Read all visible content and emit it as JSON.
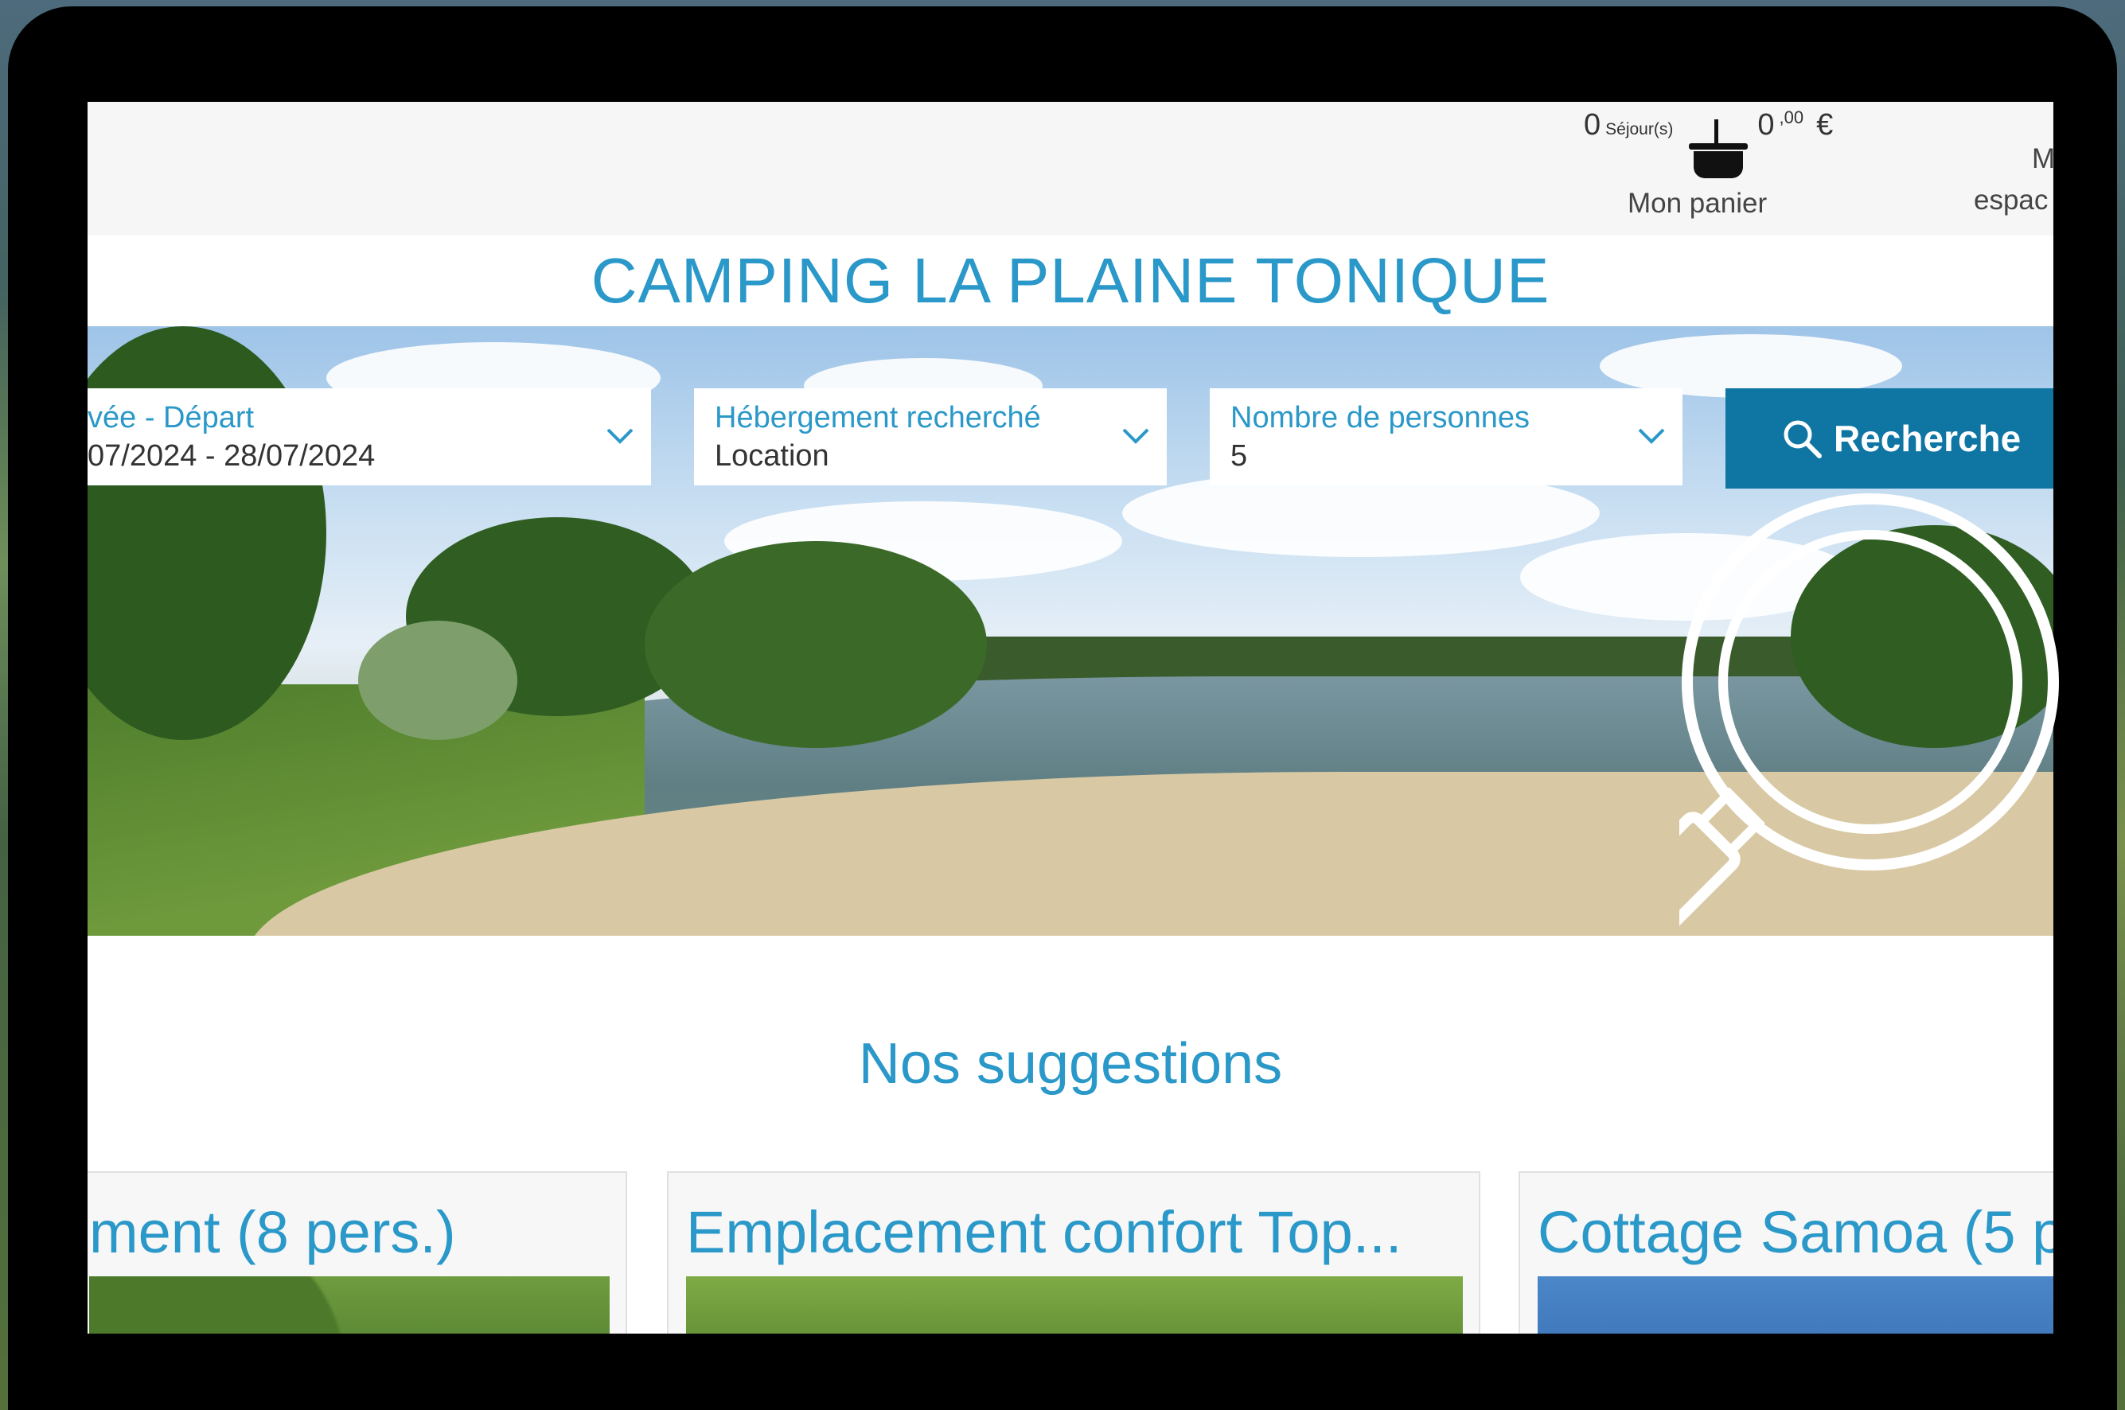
{
  "header": {
    "cart_count": "0",
    "cart_unit": "Séjour(s)",
    "cart_amount": "0",
    "cart_amount_decimals": ",00",
    "cart_currency": "€",
    "cart_label": "Mon panier",
    "account_label_line1": "M",
    "account_label_line2": "espac"
  },
  "site": {
    "title": "CAMPING LA PLAINE TONIQUE"
  },
  "search": {
    "dates_label": "vée - Départ",
    "dates_value": "07/2024 - 28/07/2024",
    "lodging_label": "Hébergement recherché",
    "lodging_value": "Location",
    "people_label": "Nombre de personnes",
    "people_value": "5",
    "button_label": "Recherche"
  },
  "suggestions": {
    "title": "Nos suggestions",
    "cards": [
      {
        "title": "ment (8 pers.)"
      },
      {
        "title": "Emplacement confort Top..."
      },
      {
        "title": "Cottage Samoa (5 p"
      }
    ]
  },
  "colors": {
    "accent": "#2a98c8",
    "button": "#0f75a3"
  },
  "icons": [
    "basket-icon",
    "chevron-down-icon",
    "search-icon",
    "magnifier-icon"
  ]
}
